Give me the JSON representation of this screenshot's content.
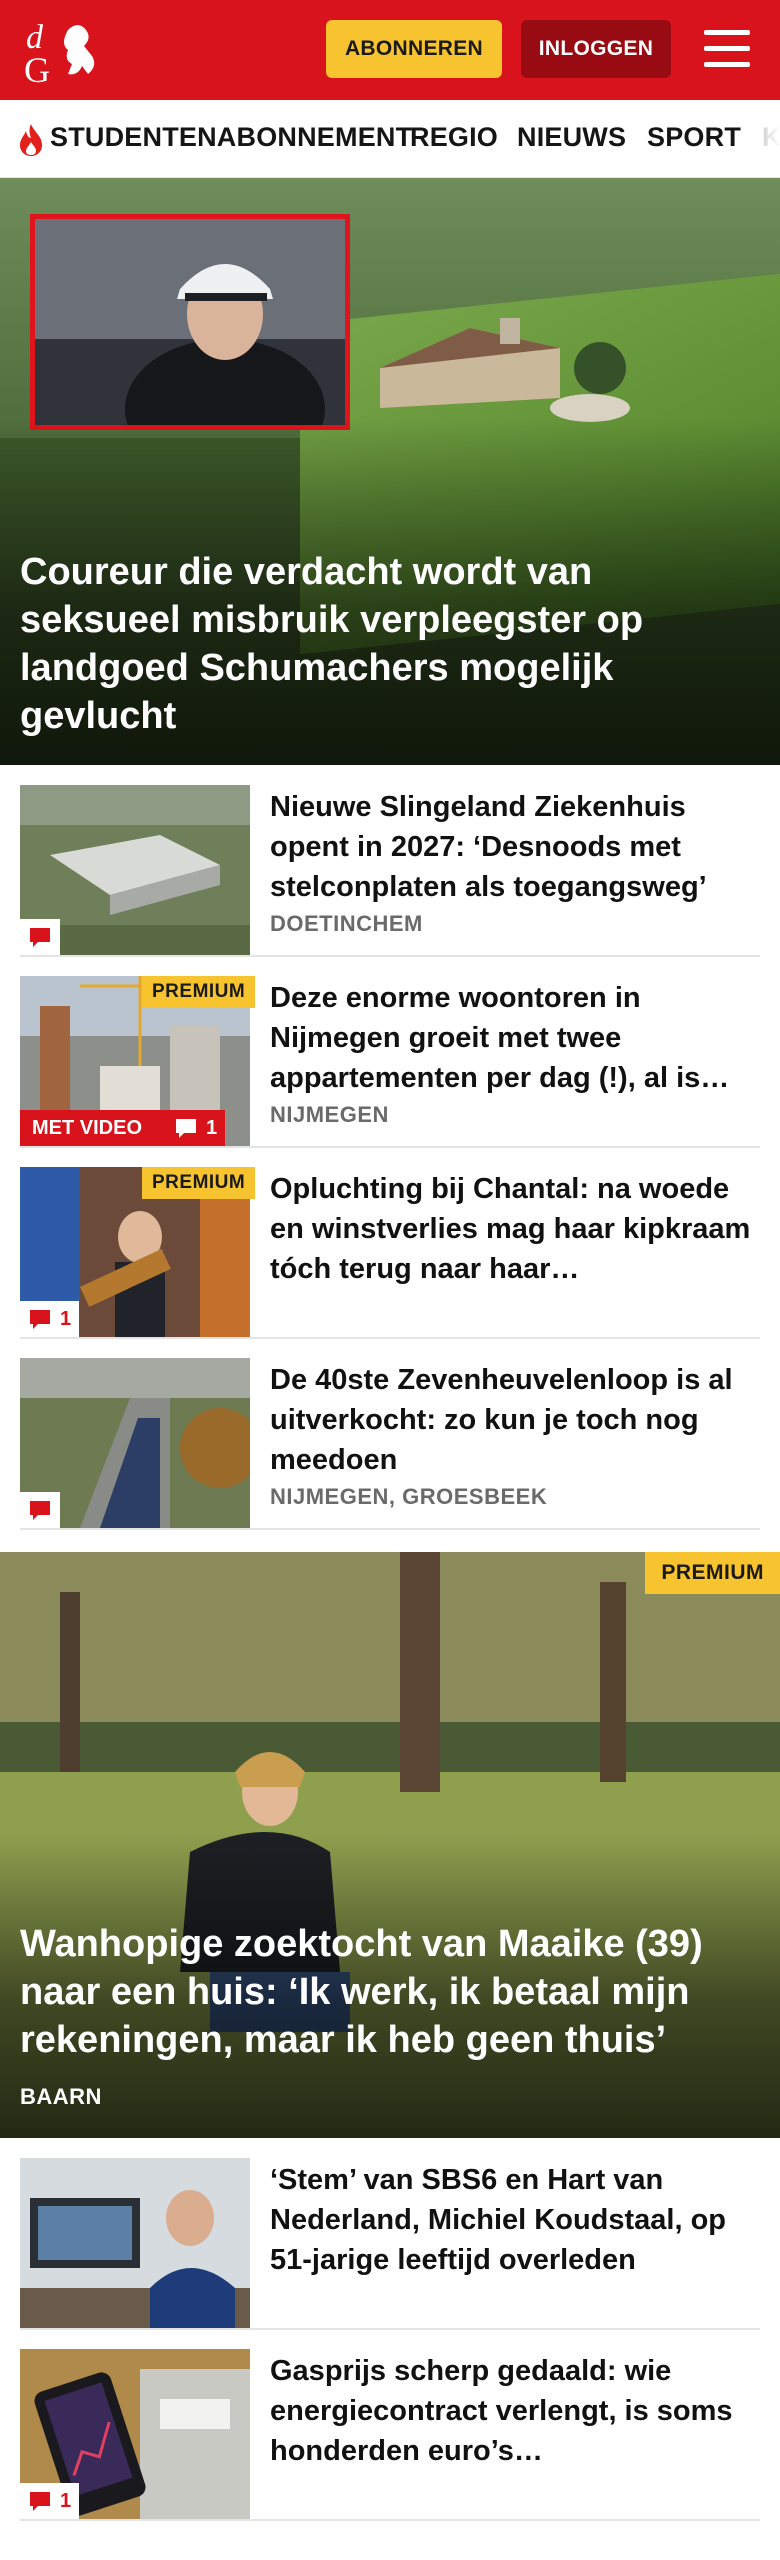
{
  "header": {
    "logo_text": "dG",
    "subscribe_label": "ABONNEREN",
    "login_label": "INLOGGEN",
    "brand_color": "#d8131b"
  },
  "nav": {
    "items": [
      {
        "label": "STUDENTENABONNEMENT",
        "icon": "flame-icon"
      },
      {
        "label": "REGIO"
      },
      {
        "label": "NIEUWS"
      },
      {
        "label": "SPORT"
      },
      {
        "label": "K"
      }
    ]
  },
  "hero": {
    "title": "Coureur die verdacht wordt van seksueel misbruik verpleegster op landgoed Schumachers mogelijk gevlucht"
  },
  "articles": [
    {
      "title": "Nieuwe Slingeland Ziekenhuis opent in 2027: ‘Desnoods met stelconplaten als toegangsweg’",
      "region": "DOETINCHEM",
      "comments": ""
    },
    {
      "title": "Deze enorme woontoren in Nijmegen groeit met twee appartementen per dag (!), al is…",
      "region": "NIJMEGEN",
      "premium": "PREMIUM",
      "video": "MET VIDEO",
      "comments": "1"
    },
    {
      "title": "Opluchting bij Chantal: na woede en winstverlies mag haar kipkraam tóch terug naar haar…",
      "premium": "PREMIUM",
      "comments": "1"
    },
    {
      "title": "De 40ste Zevenheuvelenloop is al uitverkocht: zo kun je toch nog meedoen",
      "region": "NIJMEGEN, GROESBEEK",
      "comments": ""
    }
  ],
  "feature": {
    "premium": "PREMIUM",
    "title": "Wanhopige zoektocht van Maaike (39) naar een huis: ‘Ik werk, ik betaal mijn rekeningen, maar ik heb geen thuis’",
    "region": "BAARN"
  },
  "articles2": [
    {
      "title": "‘Stem’ van SBS6 en Hart van Nederland, Michiel Koudstaal, op 51-jarige leeftijd overleden"
    },
    {
      "title": "Gasprijs scherp gedaald: wie energiecontract verlengt, is soms honderden euro’s…",
      "comments": "1"
    }
  ]
}
